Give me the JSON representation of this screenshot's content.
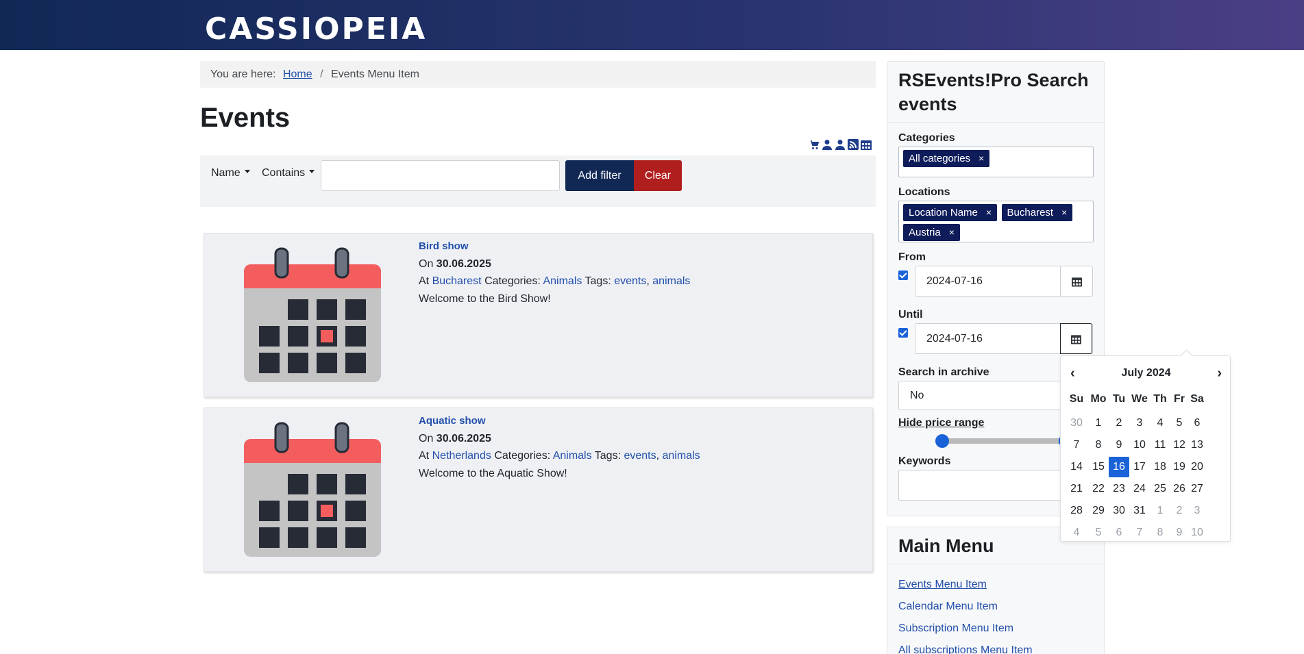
{
  "header": {
    "brand": "CASSIOPEIA"
  },
  "breadcrumb": {
    "prefix": "You are here:",
    "home": "Home",
    "current": "Events Menu Item"
  },
  "page": {
    "title": "Events"
  },
  "toolbar_icons": [
    "cart-icon",
    "user-icon",
    "user-icon",
    "rss-icon",
    "calendar-icon"
  ],
  "filter": {
    "field": "Name",
    "operator": "Contains",
    "value": "",
    "add_label": "Add filter",
    "clear_label": "Clear"
  },
  "events": [
    {
      "title": "Bird show",
      "on_label": "On",
      "date": "30.06.2025",
      "at_label": "At",
      "location": "Bucharest",
      "categories_label": "Categories:",
      "category": "Animals",
      "tags_label": "Tags:",
      "tag1": "events",
      "tag2": "animals",
      "description": "Welcome to the Bird Show!"
    },
    {
      "title": "Aquatic show",
      "on_label": "On",
      "date": "30.06.2025",
      "at_label": "At",
      "location": "Netherlands",
      "categories_label": "Categories:",
      "category": "Animals",
      "tags_label": "Tags:",
      "tag1": "events",
      "tag2": "animals",
      "description": "Welcome to the Aquatic Show!"
    }
  ],
  "search": {
    "title": "RSEvents!Pro Search events",
    "categories_label": "Categories",
    "categories": [
      "All categories"
    ],
    "locations_label": "Locations",
    "locations": [
      "Location Name",
      "Bucharest",
      "Austria"
    ],
    "from_label": "From",
    "from_value": "2024-07-16",
    "until_label": "Until",
    "until_value": "2024-07-16",
    "archive_label": "Search in archive",
    "archive_value": "No",
    "price_label": "Hide price range",
    "keywords_label": "Keywords",
    "keywords_value": ""
  },
  "menu": {
    "title": "Main Menu",
    "items": [
      "Events Menu Item",
      "Calendar Menu Item",
      "Subscription Menu Item",
      "All subscriptions Menu Item"
    ]
  },
  "calendar": {
    "prev": "‹",
    "next": "›",
    "month": "July 2024",
    "weekdays": [
      "Su",
      "Mo",
      "Tu",
      "We",
      "Th",
      "Fr",
      "Sa"
    ],
    "weeks": [
      [
        "30",
        "1",
        "2",
        "3",
        "4",
        "5",
        "6"
      ],
      [
        "7",
        "8",
        "9",
        "10",
        "11",
        "12",
        "13"
      ],
      [
        "14",
        "15",
        "16",
        "17",
        "18",
        "19",
        "20"
      ],
      [
        "21",
        "22",
        "23",
        "24",
        "25",
        "26",
        "27"
      ],
      [
        "28",
        "29",
        "30",
        "31",
        "1",
        "2",
        "3"
      ],
      [
        "4",
        "5",
        "6",
        "7",
        "8",
        "9",
        "10"
      ]
    ],
    "selected": "16",
    "colors": {
      "selected": "#1a62d8"
    }
  },
  "colors": {
    "header_start": "#112855",
    "header_end": "#4b3f86",
    "add_button": "#112855",
    "clear_button": "#b01e1e",
    "tag": "#0f1c5a",
    "link": "#224faa"
  }
}
